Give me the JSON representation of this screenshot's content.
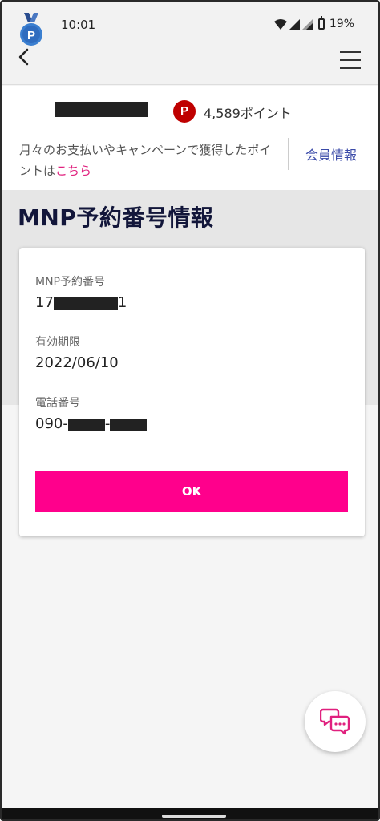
{
  "status_bar": {
    "time": "10:01",
    "battery": "19%"
  },
  "member": {
    "points": "4,589ポイント",
    "point_badge": "P",
    "description_prefix": "月々のお支払いやキャンペーンで獲得したポイントは",
    "description_link": "こちら",
    "member_info_link": "会員情報"
  },
  "page": {
    "title": "MNP予約番号情報"
  },
  "card": {
    "mnp_label": "MNP予約番号",
    "mnp_prefix": "17",
    "mnp_suffix": "1",
    "expiry_label": "有効期限",
    "expiry_value": "2022/06/10",
    "phone_label": "電話番号",
    "phone_prefix": "090-",
    "phone_sep": "-",
    "ok_label": "OK"
  },
  "colors": {
    "accent": "#ff008c",
    "link": "#e0207e",
    "member_link": "#3a4aa8",
    "point_badge": "#bf0000"
  },
  "icons": [
    "back-arrow-icon",
    "hamburger-menu-icon",
    "rank-medal-icon",
    "chat-support-icon"
  ]
}
